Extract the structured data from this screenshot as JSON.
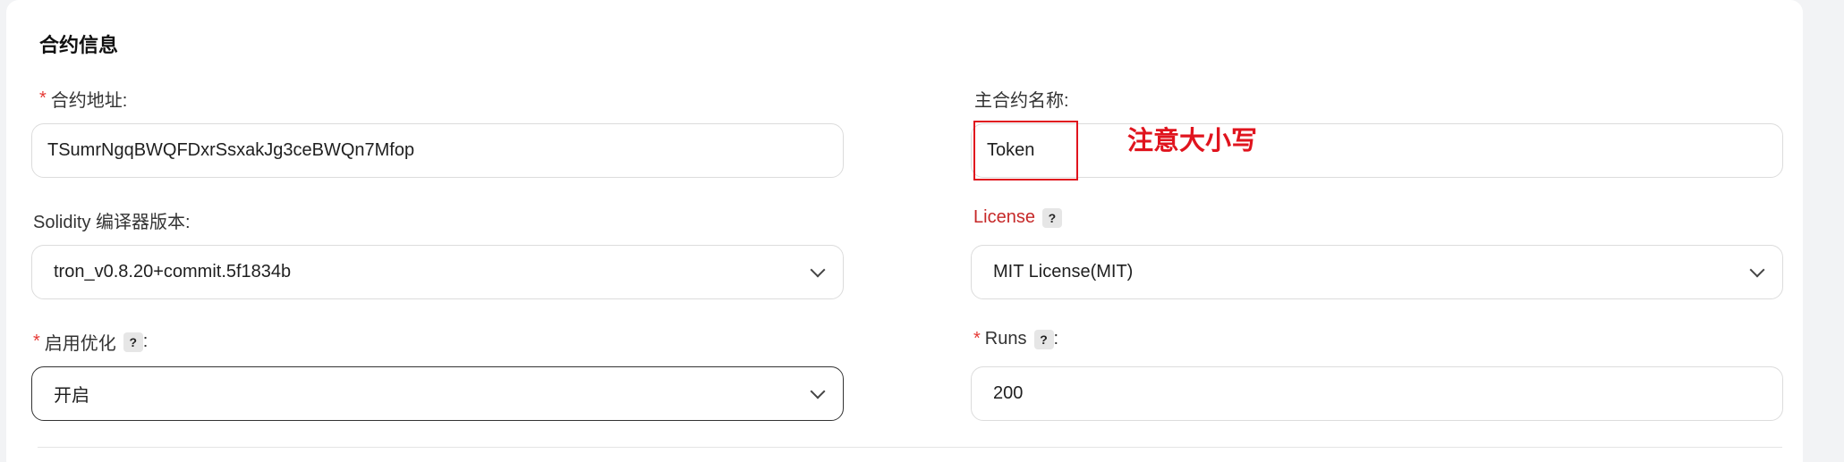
{
  "section": {
    "title": "合约信息"
  },
  "contract_address": {
    "label": "合约地址:",
    "required": "*",
    "value": "TSumrNgqBWQFDxrSsxakJg3ceBWQn7Mfop"
  },
  "main_contract_name": {
    "label": "主合约名称:",
    "value": "Token"
  },
  "annotation": {
    "text": "注意大小写",
    "color": "#e0141e"
  },
  "compiler_version": {
    "label": "Solidity 编译器版本:",
    "value": "tron_v0.8.20+commit.5f1834b",
    "icon": "chevron-down-icon"
  },
  "license": {
    "label": "License",
    "help": "?",
    "value": "MIT License(MIT)",
    "icon": "chevron-down-icon"
  },
  "optimization": {
    "label": "启用优化",
    "required": "*",
    "help": "?",
    "colon": ":",
    "value": "开启",
    "icon": "chevron-down-icon"
  },
  "runs": {
    "label": "Runs",
    "required": "*",
    "help": "?",
    "colon": ":",
    "value": "200"
  },
  "colors": {
    "required": "#e53935",
    "license_label": "#c62828"
  }
}
